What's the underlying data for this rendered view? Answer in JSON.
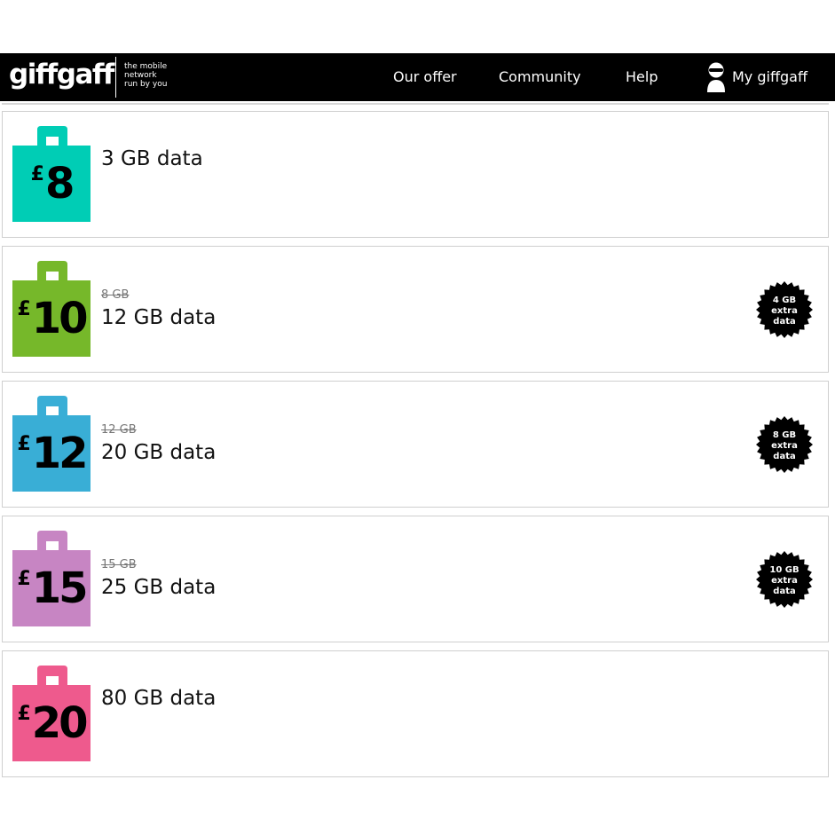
{
  "header": {
    "logo": "giffgaff",
    "tagline": [
      "the mobile",
      "network",
      "run by you"
    ],
    "nav": {
      "our_offer": "Our offer",
      "community": "Community",
      "help": "Help",
      "my_account": "My giffgaff"
    }
  },
  "plans": [
    {
      "currency": "£",
      "price": "8",
      "color": "#00cdb5",
      "old_data": "",
      "data": "3 GB data",
      "badge": null
    },
    {
      "currency": "£",
      "price": "10",
      "color": "#76b82a",
      "old_data": "8 GB",
      "data": "12 GB data",
      "badge": [
        "4 GB",
        "extra",
        "data"
      ]
    },
    {
      "currency": "£",
      "price": "12",
      "color": "#39aed6",
      "old_data": "12 GB",
      "data": "20 GB data",
      "badge": [
        "8 GB",
        "extra",
        "data"
      ]
    },
    {
      "currency": "£",
      "price": "15",
      "color": "#c785c3",
      "old_data": "15 GB",
      "data": "25 GB data",
      "badge": [
        "10 GB",
        "extra",
        "data"
      ]
    },
    {
      "currency": "£",
      "price": "20",
      "color": "#ee5a8d",
      "old_data": "",
      "data": "80 GB data",
      "badge": null
    }
  ]
}
